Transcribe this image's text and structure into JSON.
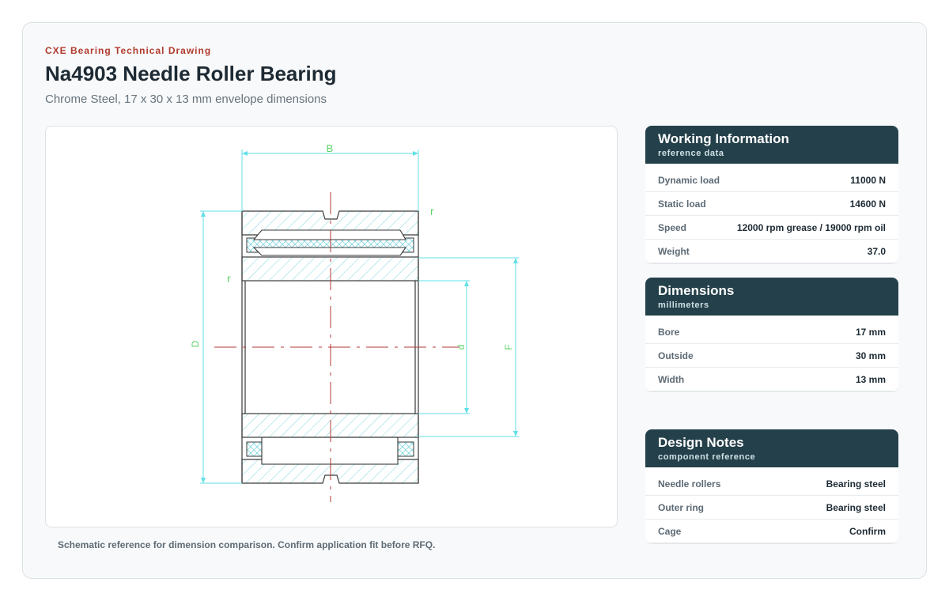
{
  "header": {
    "eyebrow": "CXE Bearing Technical Drawing",
    "title": "Na4903 Needle Roller Bearing",
    "subtitle": "Chrome Steel, 17 x 30 x 13 mm envelope dimensions"
  },
  "drawing": {
    "labels": {
      "b": "B",
      "r_top": "r",
      "r_side": "r",
      "d_outer": "D",
      "d_bore": "d",
      "f": "F"
    },
    "caption": "Schematic reference for dimension comparison. Confirm application fit before RFQ.",
    "colors": {
      "outline": "#3a3a3a",
      "hatch": "#7fd6df",
      "dimension": "#62dfe6",
      "center": "#b23a34",
      "label": "#5fd36a"
    }
  },
  "cards": {
    "working": {
      "title": "Working Information",
      "subtitle": "reference data",
      "rows": [
        {
          "label": "Dynamic load",
          "value": "11000 N"
        },
        {
          "label": "Static load",
          "value": "14600 N"
        },
        {
          "label": "Speed",
          "value": "12000 rpm grease / 19000 rpm oil"
        },
        {
          "label": "Weight",
          "value": "37.0"
        }
      ]
    },
    "dimensions": {
      "title": "Dimensions",
      "subtitle": "millimeters",
      "rows": [
        {
          "label": "Bore",
          "value": "17 mm"
        },
        {
          "label": "Outside",
          "value": "30 mm"
        },
        {
          "label": "Width",
          "value": "13 mm"
        }
      ]
    },
    "notes": {
      "title": "Design Notes",
      "subtitle": "component reference",
      "rows": [
        {
          "label": "Needle rollers",
          "value": "Bearing steel"
        },
        {
          "label": "Outer ring",
          "value": "Bearing steel"
        },
        {
          "label": "Cage",
          "value": "Confirm"
        }
      ]
    }
  }
}
